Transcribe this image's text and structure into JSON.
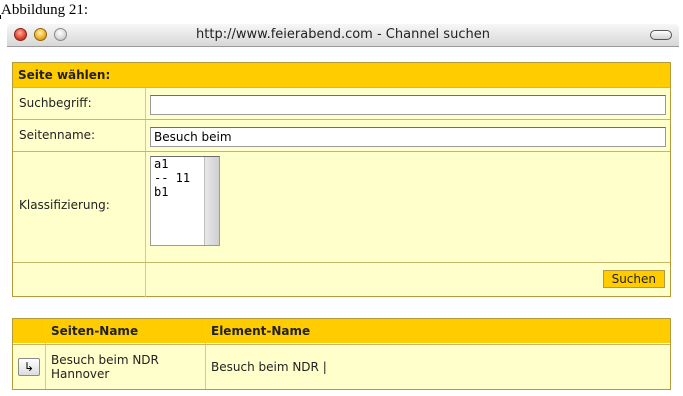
{
  "caption": "Abbildung 21:",
  "window": {
    "title": "http://www.feierabend.com - Channel suchen"
  },
  "form": {
    "header": "Seite wählen:",
    "search_label": "Suchbegriff:",
    "search_value": "",
    "pagename_label": "Seitenname:",
    "pagename_value": "Besuch beim",
    "classification_label": "Klassifizierung:",
    "classification_options": [
      "a1",
      "-- 11",
      "b1"
    ],
    "search_button": "Suchen"
  },
  "results": {
    "columns": [
      "Seiten-Name",
      "Element-Name"
    ],
    "rows": [
      {
        "page_name_line1": "Besuch beim NDR",
        "page_name_line2": "Hannover",
        "element_name": "Besuch beim NDR |"
      }
    ]
  },
  "icons": {
    "select_arrow": "arrow-select-icon"
  }
}
